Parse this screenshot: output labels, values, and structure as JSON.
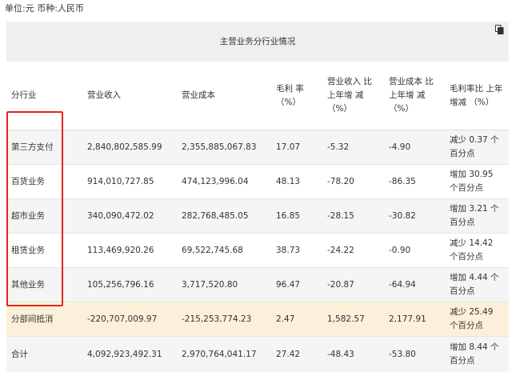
{
  "unit_note": "单位:元 币种:人民币",
  "table_title": "主营业务分行业情况",
  "icons": {
    "copy": "copy-icon"
  },
  "highlight_color": "#e0261c",
  "headers": [
    "分行业",
    "营业收入",
    "营业成本",
    "毛利 率（%）",
    "营业收入 比上年增 减（%）",
    "营业成本 比上年增 减（%）",
    "毛利率比 上年增减 （%）"
  ],
  "rows": [
    [
      "第三方支付",
      "2,840,802,585.99",
      "2,355,885,067.83",
      "17.07",
      "-5.32",
      "-4.90",
      "减少 0.37 个百分点"
    ],
    [
      "百货业务",
      "914,010,727.85",
      "474,123,996.04",
      "48.13",
      "-78.20",
      "-86.35",
      "增加 30.95 个百分点"
    ],
    [
      "超市业务",
      "340,090,472.02",
      "282,768,485.05",
      "16.85",
      "-28.15",
      "-30.82",
      "增加 3.21 个百分点"
    ],
    [
      "租赁业务",
      "113,469,920.26",
      "69,522,745.68",
      "38.73",
      "-24.22",
      "-0.90",
      "减少 14.42 个百分点"
    ],
    [
      "其他业务",
      "105,256,796.16",
      "3,717,520.80",
      "96.47",
      "-20.87",
      "-64.94",
      "增加 4.44 个百分点"
    ],
    [
      "分部间抵消",
      "-220,707,009.97",
      "-215,253,774.23",
      "2.47",
      "1,582.57",
      "2,177.91",
      "减少 25.49 个百分点"
    ],
    [
      "合计",
      "4,092,923,492.31",
      "2,970,764,041.17",
      "27.42",
      "-48.43",
      "-53.80",
      "增加 8.44 个百分点"
    ]
  ]
}
